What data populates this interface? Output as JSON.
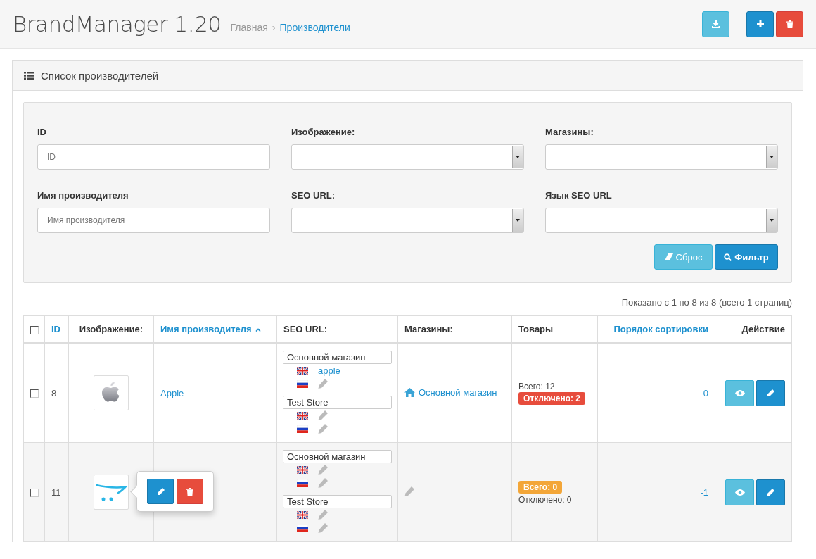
{
  "header": {
    "title": "BrandManager 1.20",
    "breadcrumbs": [
      {
        "label": "Главная",
        "current": false
      },
      {
        "label": "Производители",
        "current": true
      }
    ],
    "breadcrumb_separator": "›",
    "buttons": [
      {
        "kind": "download"
      },
      {
        "kind": "add"
      },
      {
        "kind": "delete"
      }
    ]
  },
  "panel": {
    "title": "Список производителей"
  },
  "filters": [
    {
      "label": "ID",
      "kind": "text",
      "placeholder": "ID"
    },
    {
      "label": "Изображение:",
      "kind": "select"
    },
    {
      "label": "Магазины:",
      "kind": "select"
    },
    {
      "label": "Имя производителя",
      "kind": "text",
      "placeholder": "Имя производителя"
    },
    {
      "label": "SEO URL:",
      "kind": "select"
    },
    {
      "label": "Язык SEO URL",
      "kind": "select"
    }
  ],
  "filter_buttons": [
    {
      "kind": "reset",
      "label": "Сброс"
    },
    {
      "kind": "filter",
      "label": "Фильтр"
    }
  ],
  "summary": "Показано с 1 по 8 из 8 (всего 1 страниц)",
  "table": {
    "select_all_checked": false,
    "columns": [
      {
        "label": "ID",
        "link": true,
        "sorted_asc": false
      },
      {
        "label": "Изображение:",
        "link": false,
        "sorted_asc": false
      },
      {
        "label": "Имя производителя",
        "link": true,
        "sorted_asc": true
      },
      {
        "label": "SEO URL:",
        "link": false,
        "sorted_asc": false
      },
      {
        "label": "Магазины:",
        "link": false,
        "sorted_asc": false
      },
      {
        "label": "Товары",
        "link": false,
        "sorted_asc": false
      },
      {
        "label": "Порядок сортировки",
        "link": true,
        "sorted_asc": false
      },
      {
        "label": "Действие",
        "link": false,
        "sorted_asc": false
      }
    ],
    "rows": [
      {
        "checked": false,
        "id": "8",
        "logo": {
          "kind": "apple"
        },
        "name": "Apple",
        "seo": [
          {
            "store": "Основной магазин",
            "langs": [
              {
                "kind": "en",
                "keyword": "apple"
              },
              {
                "kind": "ru"
              }
            ]
          },
          {
            "store": "Test Store",
            "langs": [
              {
                "kind": "en"
              },
              {
                "kind": "ru"
              }
            ]
          }
        ],
        "store": "Основной магазин",
        "products": [
          {
            "text": "Всего: 12",
            "kind": "plain"
          },
          {
            "text": "Отключено: 2",
            "kind": "danger"
          }
        ],
        "sort_order": "0"
      },
      {
        "checked": false,
        "id": "11",
        "logo": {
          "kind": "cart"
        },
        "image_popover": {
          "actions": [
            {
              "kind": "edit"
            },
            {
              "kind": "delete"
            }
          ]
        },
        "seo": [
          {
            "store": "Основной магазин",
            "langs": [
              {
                "kind": "en"
              },
              {
                "kind": "ru"
              }
            ]
          },
          {
            "store": "Test Store",
            "langs": [
              {
                "kind": "en"
              },
              {
                "kind": "ru"
              }
            ]
          }
        ],
        "products": [
          {
            "text": "Всего: 0",
            "kind": "warning"
          },
          {
            "text": "Отключено: 0",
            "kind": "plain"
          }
        ],
        "sort_order": "-1"
      }
    ]
  }
}
